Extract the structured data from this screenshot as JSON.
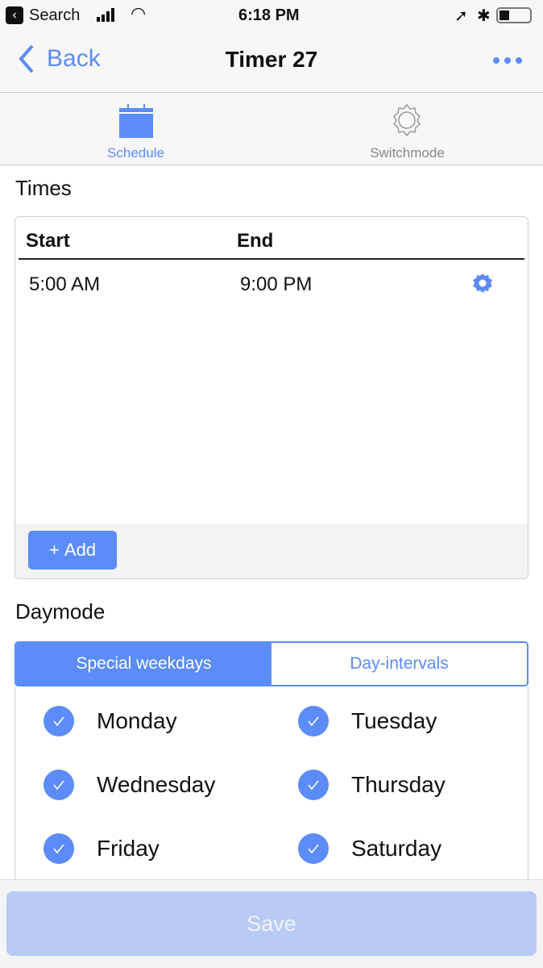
{
  "status_bar": {
    "back_app": "Search",
    "time": "6:18 PM"
  },
  "nav": {
    "back": "Back",
    "title": "Timer 27",
    "more_icon": "ellipsis-icon"
  },
  "tabs": [
    {
      "label": "Schedule",
      "icon": "calendar-icon",
      "active": true
    },
    {
      "label": "Switchmode",
      "icon": "gear-icon",
      "active": false
    }
  ],
  "times": {
    "title": "Times",
    "headers": [
      "Start",
      "End"
    ],
    "rows": [
      {
        "start": "5:00 AM",
        "end": "9:00 PM"
      }
    ],
    "add": "Add"
  },
  "daymode": {
    "title": "Daymode",
    "segments": [
      "Special weekdays",
      "Day-intervals"
    ],
    "selected": 0,
    "days": [
      {
        "label": "Monday",
        "checked": true
      },
      {
        "label": "Tuesday",
        "checked": true
      },
      {
        "label": "Wednesday",
        "checked": true
      },
      {
        "label": "Thursday",
        "checked": true
      },
      {
        "label": "Friday",
        "checked": true
      },
      {
        "label": "Saturday",
        "checked": true
      }
    ]
  },
  "save": "Save",
  "colors": {
    "accent": "#5b8cf7",
    "save_disabled": "#b8cbf5"
  }
}
